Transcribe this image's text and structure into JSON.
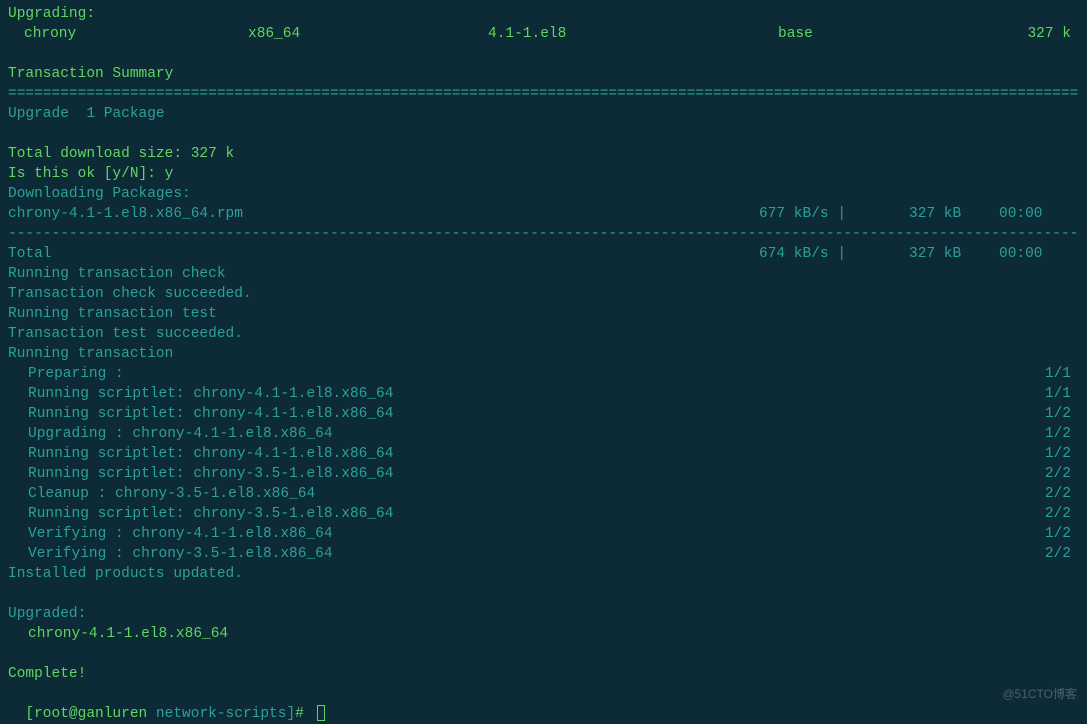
{
  "header": {
    "upgrading_label": "Upgrading:",
    "package": {
      "name": "chrony",
      "arch": "x86_64",
      "version": "4.1-1.el8",
      "repo": "base",
      "size": "327 k"
    }
  },
  "transaction_summary_label": "Transaction Summary",
  "divider_eq": "========================================================================================================================================",
  "upgrade_count_line": "Upgrade  1 Package",
  "download_size_line": "Total download size: 327 k",
  "confirm_line": "Is this ok [y/N]: y",
  "downloading_label": "Downloading Packages:",
  "download_row": {
    "file": "chrony-4.1-1.el8.x86_64.rpm",
    "rate": "677 kB/s |",
    "size": "327 kB",
    "time": "00:00"
  },
  "divider_dash": "----------------------------------------------------------------------------------------------------------------------------------------",
  "total_row": {
    "label": "Total",
    "rate": "674 kB/s |",
    "size": "327 kB",
    "time": "00:00"
  },
  "check_lines": [
    "Running transaction check",
    "Transaction check succeeded.",
    "Running transaction test",
    "Transaction test succeeded.",
    "Running transaction"
  ],
  "steps": [
    {
      "action": "Preparing        :",
      "pkg": "",
      "count": "1/1"
    },
    {
      "action": "Running scriptlet:",
      "pkg": "chrony-4.1-1.el8.x86_64",
      "count": "1/1"
    },
    {
      "action": "Running scriptlet:",
      "pkg": "chrony-4.1-1.el8.x86_64",
      "count": "1/2"
    },
    {
      "action": "Upgrading        :",
      "pkg": "chrony-4.1-1.el8.x86_64",
      "count": "1/2"
    },
    {
      "action": "Running scriptlet:",
      "pkg": "chrony-4.1-1.el8.x86_64",
      "count": "1/2"
    },
    {
      "action": "Running scriptlet:",
      "pkg": "chrony-3.5-1.el8.x86_64",
      "count": "2/2"
    },
    {
      "action": "Cleanup          :",
      "pkg": "chrony-3.5-1.el8.x86_64",
      "count": "2/2"
    },
    {
      "action": "Running scriptlet:",
      "pkg": "chrony-3.5-1.el8.x86_64",
      "count": "2/2"
    },
    {
      "action": "Verifying        :",
      "pkg": "chrony-4.1-1.el8.x86_64",
      "count": "1/2"
    },
    {
      "action": "Verifying        :",
      "pkg": "chrony-3.5-1.el8.x86_64",
      "count": "2/2"
    }
  ],
  "installed_updated": "Installed products updated.",
  "upgraded_label": "Upgraded:",
  "upgraded_pkg": "chrony-4.1-1.el8.x86_64",
  "complete": "Complete!",
  "prompt": {
    "user_host": "[root@ganluren",
    "path": " network-scripts]",
    "symbol": "# "
  },
  "watermark": "@51CTO博客"
}
